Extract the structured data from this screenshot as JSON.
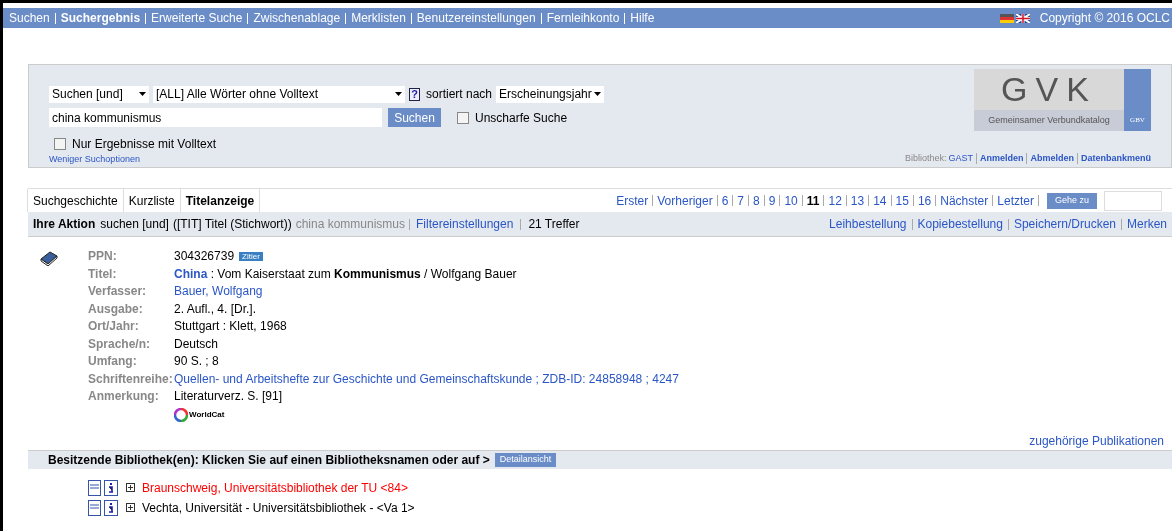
{
  "nav": {
    "items": [
      {
        "label": "Suchen",
        "selected": false
      },
      {
        "label": "Suchergebnis",
        "selected": true
      },
      {
        "label": "Erweiterte Suche",
        "selected": false
      },
      {
        "label": "Zwischenablage",
        "selected": false
      },
      {
        "label": "Merklisten",
        "selected": false
      },
      {
        "label": "Benutzereinstellungen",
        "selected": false
      },
      {
        "label": "Fernleihkonto",
        "selected": false
      },
      {
        "label": "Hilfe",
        "selected": false
      }
    ],
    "copyright": "Copyright © 2016 OCLC"
  },
  "search": {
    "operator": "Suchen [und]",
    "index": "[ALL] Alle Wörter ohne Volltext",
    "help": "?",
    "sort_label": "sortiert nach",
    "sort": "Erscheinungsjahr",
    "query": "china kommunismus",
    "submit": "Suchen",
    "fuzzy": {
      "label": "Unscharfe Suche",
      "checked": false
    },
    "fulltext_only": {
      "label": "Nur Ergebnisse mit Volltext",
      "checked": false
    },
    "less_options": "Weniger Suchoptionen"
  },
  "logo": {
    "title": "GVK",
    "subtitle": "Gemeinsamer Verbundkatalog",
    "badge": "GBV"
  },
  "library_bar": {
    "label": "Bibliothek:",
    "library": "GAST",
    "links": [
      "Anmelden",
      "Abmelden",
      "Datenbankmenü"
    ]
  },
  "tabs": [
    {
      "label": "Suchgeschichte",
      "selected": false
    },
    {
      "label": "Kurzliste",
      "selected": false
    },
    {
      "label": "Titelanzeige",
      "selected": true
    }
  ],
  "pagination": {
    "items": [
      {
        "label": "Erster",
        "selected": false
      },
      {
        "label": "Vorheriger",
        "selected": false
      },
      {
        "label": "6",
        "selected": false
      },
      {
        "label": "7",
        "selected": false
      },
      {
        "label": "8",
        "selected": false
      },
      {
        "label": "9",
        "selected": false
      },
      {
        "label": "10",
        "selected": false
      },
      {
        "label": "11",
        "selected": true
      },
      {
        "label": "12",
        "selected": false
      },
      {
        "label": "13",
        "selected": false
      },
      {
        "label": "14",
        "selected": false
      },
      {
        "label": "15",
        "selected": false
      },
      {
        "label": "16",
        "selected": false
      },
      {
        "label": "Nächster",
        "selected": false
      },
      {
        "label": "Letzter",
        "selected": false
      }
    ],
    "goto": "Gehe zu"
  },
  "action": {
    "label": "Ihre Aktion",
    "command": "suchen [und]",
    "index": "([TIT] Titel (Stichwort))",
    "terms": "china kommunismus",
    "filter": "Filtereinstellungen",
    "hits": "21 Treffer",
    "links": [
      "Leihbestellung",
      "Kopiebestellung",
      "Speichern/Drucken",
      "Merken"
    ]
  },
  "record": {
    "fields": [
      {
        "label": "PPN:",
        "kind": "ppn",
        "value": "304326739",
        "badge": "Zitier"
      },
      {
        "label": "Titel:",
        "kind": "title",
        "parts": [
          {
            "text": "China",
            "kind": "link"
          },
          {
            "text": " : Vom Kaiserstaat zum ",
            "kind": "plain"
          },
          {
            "text": "Kommunismus",
            "kind": "bold"
          },
          {
            "text": " / Wolfgang Bauer",
            "kind": "plain"
          }
        ]
      },
      {
        "label": "Verfasser:",
        "kind": "link",
        "value": "Bauer, Wolfgang"
      },
      {
        "label": "Ausgabe:",
        "kind": "plain",
        "value": "2. Aufl., 4. [Dr.]."
      },
      {
        "label": "Ort/Jahr:",
        "kind": "plain",
        "value": "Stuttgart : Klett, 1968"
      },
      {
        "label": "Sprache/n:",
        "kind": "plain",
        "value": "Deutsch"
      },
      {
        "label": "Umfang:",
        "kind": "plain",
        "value": "90 S. ; 8"
      },
      {
        "label": "Schriftenreihe:",
        "kind": "link",
        "value": "Quellen- und Arbeitshefte zur Geschichte und Gemeinschaftskunde ; ZDB-ID: 24858948 ; 4247"
      },
      {
        "label": "Anmerkung:",
        "kind": "plain",
        "value": "Literaturverz. S. [91]"
      }
    ],
    "worldcat": "WorldCat",
    "related": "zugehörige Publikationen"
  },
  "holdings": {
    "heading": "Besitzende Bibliothek(en): Klicken Sie auf einen Bibliotheksnamen oder auf >",
    "detail": "Detailansicht",
    "libraries": [
      {
        "name": "Braunschweig, Universitätsbibliothek der TU <84>",
        "color": "#ff0000"
      },
      {
        "name": "Vechta, Universität - Universitätsbibliothek - <Va 1>",
        "color": "#000000"
      }
    ]
  }
}
